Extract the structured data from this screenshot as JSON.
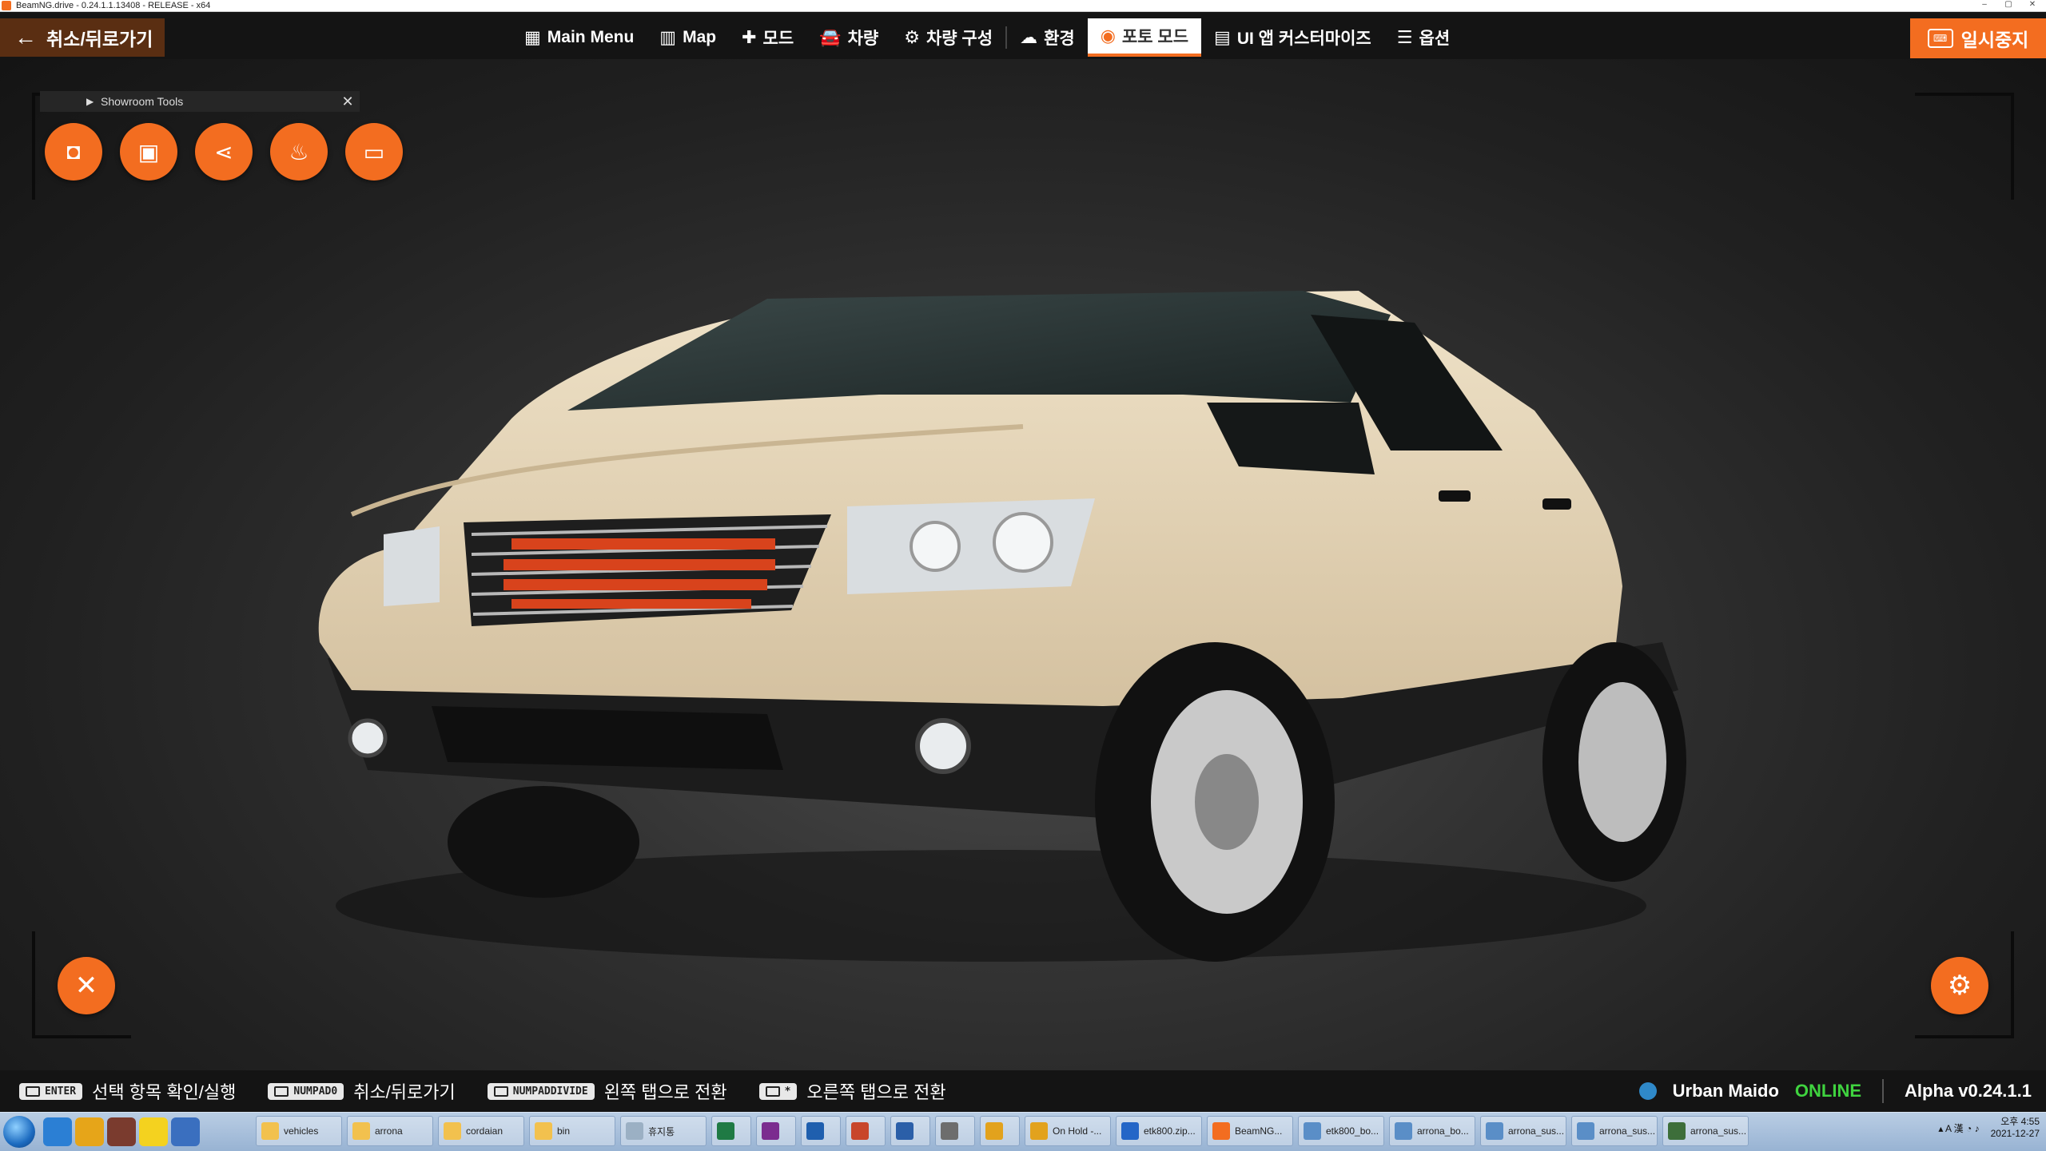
{
  "window": {
    "title": "BeamNG.drive - 0.24.1.1.13408 - RELEASE - x64"
  },
  "topnav": {
    "back_label": "취소/뒤로가기",
    "items": [
      {
        "label": "Main Menu",
        "icon": "grid-icon"
      },
      {
        "label": "Map",
        "icon": "map-icon"
      },
      {
        "label": "모드",
        "icon": "puzzle-icon"
      },
      {
        "label": "차량",
        "icon": "car-icon"
      },
      {
        "label": "차량 구성",
        "icon": "engine-icon"
      },
      {
        "label": "환경",
        "icon": "weather-icon"
      },
      {
        "label": "포토 모드",
        "icon": "camera-icon",
        "active": true
      },
      {
        "label": "UI 앱 커스터마이즈",
        "icon": "ui-apps-icon"
      },
      {
        "label": "옵션",
        "icon": "sliders-icon"
      }
    ],
    "pause_label": "일시중지"
  },
  "showroom": {
    "title": "Showroom Tools",
    "tools": [
      "camera-icon",
      "screenshot-icon",
      "share-icon",
      "steam-icon",
      "folder-icon"
    ]
  },
  "hints": [
    {
      "key": "ENTER",
      "label": "선택 항목 확인/실행"
    },
    {
      "key": "NUMPAD0",
      "label": "취소/뒤로가기"
    },
    {
      "key": "NUMPADDIVIDE",
      "label": "왼쪽 탭으로 전환"
    },
    {
      "key": "*",
      "label": "오른쪽 탭으로 전환"
    }
  ],
  "status": {
    "user": "Urban Maido",
    "online": "ONLINE",
    "version": "Alpha v0.24.1.1"
  },
  "taskbar": {
    "tasks": [
      {
        "label": "vehicles",
        "color": "#f2c14e"
      },
      {
        "label": "arrona",
        "color": "#f2c14e"
      },
      {
        "label": "cordaian",
        "color": "#f2c14e"
      },
      {
        "label": "bin",
        "color": "#f2c14e"
      },
      {
        "label": "휴지통",
        "color": "#9bb0c4"
      },
      {
        "label": "",
        "color": "#1f7a44"
      },
      {
        "label": "",
        "color": "#7b2c8f"
      },
      {
        "label": "",
        "color": "#1f5fae"
      },
      {
        "label": "",
        "color": "#c8462b"
      },
      {
        "label": "",
        "color": "#2b5fa8"
      },
      {
        "label": "",
        "color": "#6d6d6d"
      },
      {
        "label": "",
        "color": "#e2a21d"
      },
      {
        "label": "On Hold -...",
        "color": "#e2a21d"
      },
      {
        "label": "etk800.zip...",
        "color": "#2466c7"
      },
      {
        "label": "BeamNG...",
        "color": "#f36d20"
      },
      {
        "label": "etk800_bo...",
        "color": "#5a8ec7"
      },
      {
        "label": "arrona_bo...",
        "color": "#5a8ec7"
      },
      {
        "label": "arrona_sus...",
        "color": "#5a8ec7"
      },
      {
        "label": "arrona_sus...",
        "color": "#5a8ec7"
      },
      {
        "label": "arrona_sus...",
        "color": "#3d6e3a"
      }
    ],
    "clock_time": "오후 4:55",
    "clock_date": "2021-12-27"
  },
  "colors": {
    "accent": "#f36d20",
    "online": "#3fd33f"
  }
}
